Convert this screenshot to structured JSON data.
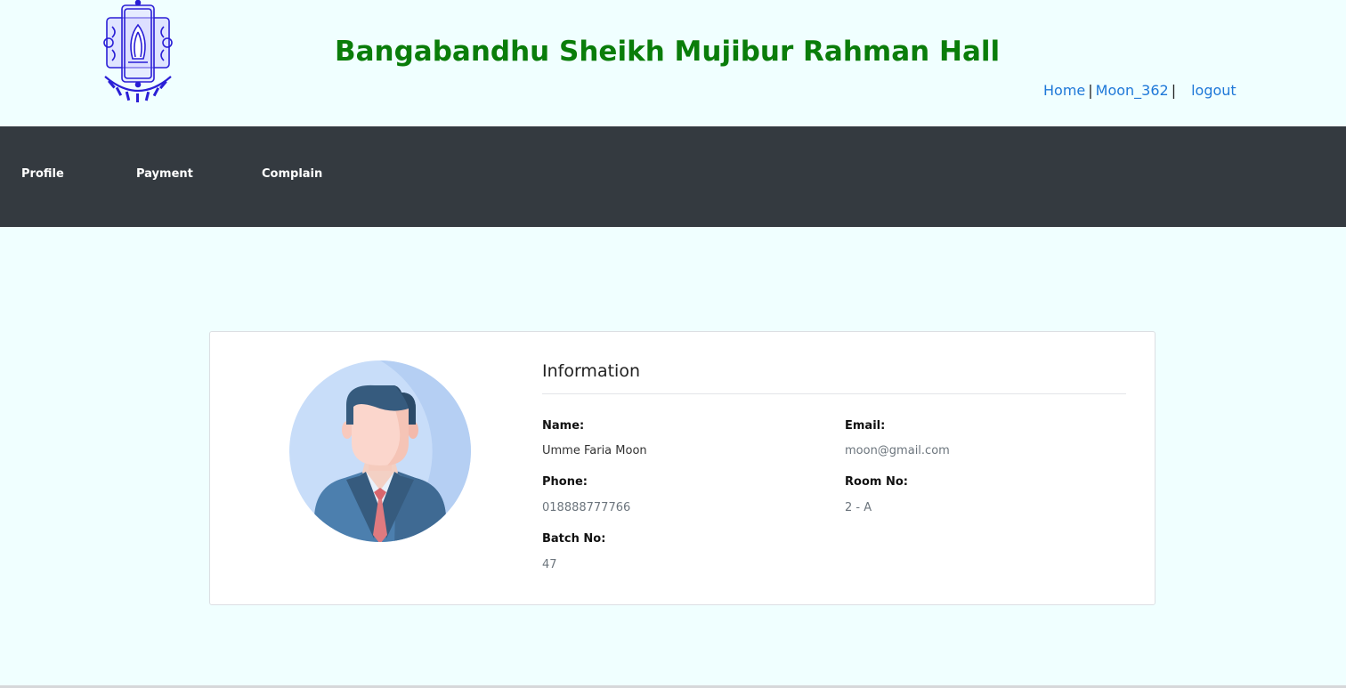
{
  "header": {
    "title": "Bangabandhu Sheikh Mujibur Rahman Hall",
    "title_color": "#0a7d0a",
    "logo_icon": "university-seal-icon",
    "links": {
      "home": "Home",
      "user": "Moon_362",
      "separator": "|",
      "logout": "logout"
    }
  },
  "navbar": {
    "background": "#343a40",
    "items": [
      {
        "label": "Profile"
      },
      {
        "label": "Payment"
      },
      {
        "label": "Complain"
      }
    ]
  },
  "profile": {
    "avatar_icon": "user-avatar-icon",
    "section_title": "Information",
    "fields": {
      "name": {
        "label": "Name:",
        "value": "Umme Faria Moon"
      },
      "email": {
        "label": "Email:",
        "value": "moon@gmail.com"
      },
      "phone": {
        "label": "Phone:",
        "value": "018888777766"
      },
      "room": {
        "label": "Room No:",
        "value": "2 - A"
      },
      "batch": {
        "label": "Batch No:",
        "value": "47"
      }
    }
  }
}
